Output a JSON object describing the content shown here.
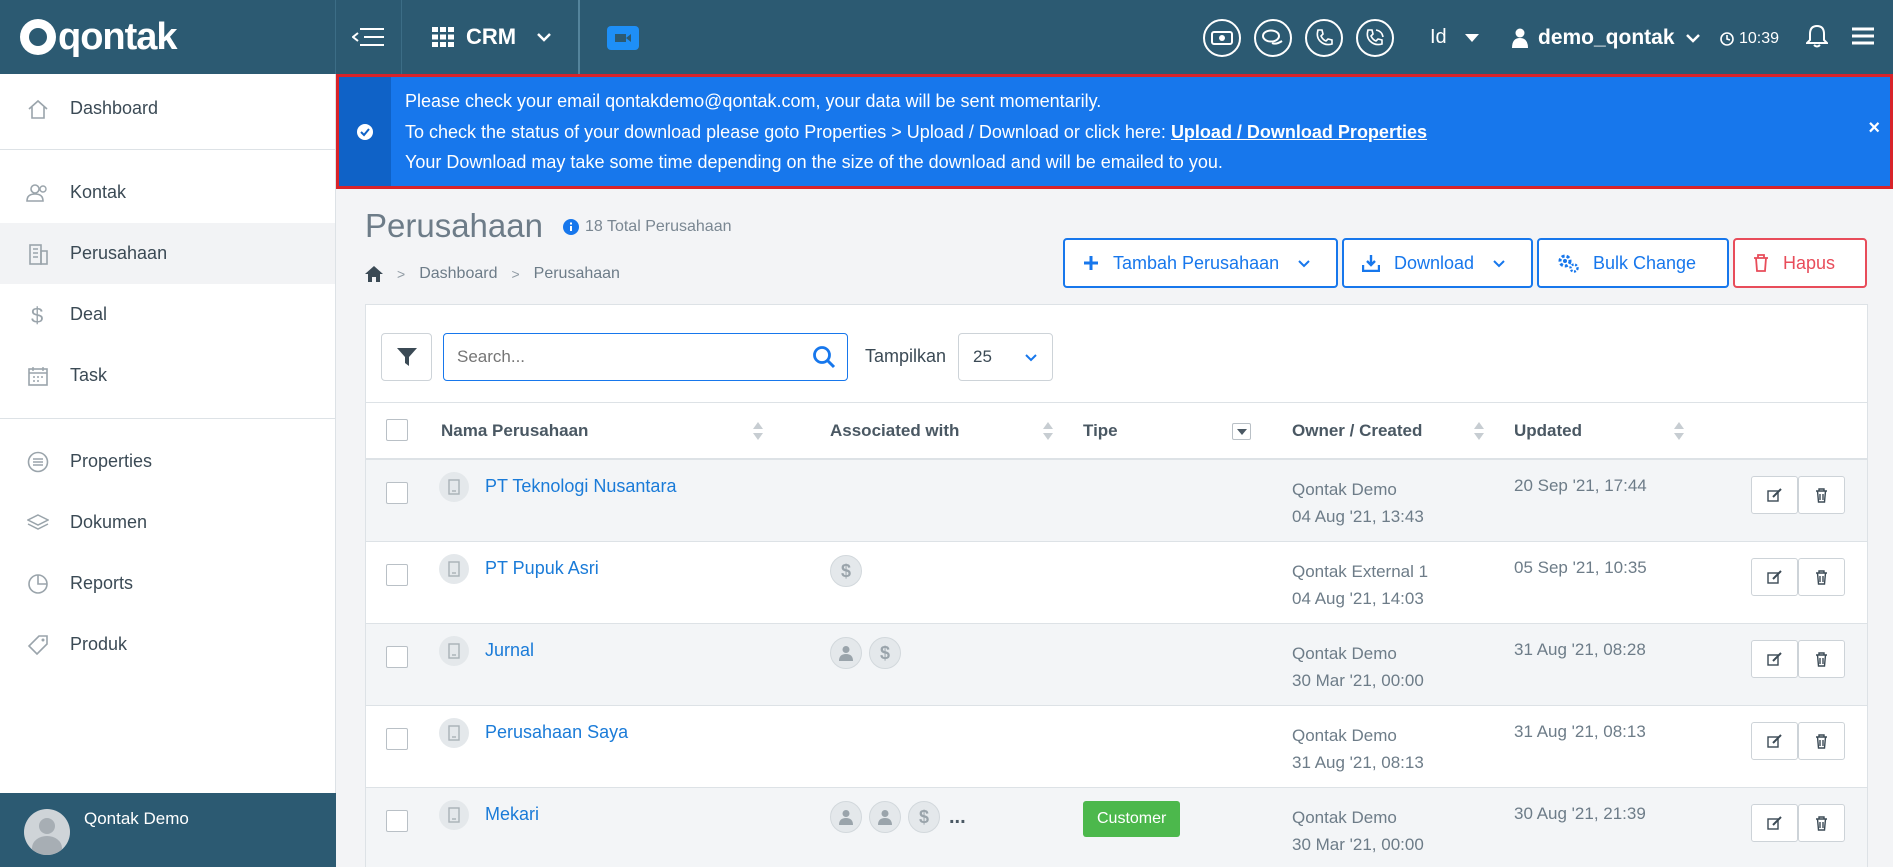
{
  "brand": {
    "logo_text": "qontak"
  },
  "topbar": {
    "app_switch": "CRM",
    "language": "Id",
    "username": "demo_qontak",
    "time": "10:39"
  },
  "sidebar": {
    "items": [
      {
        "label": "Dashboard",
        "icon": "home-icon"
      },
      {
        "label": "Kontak",
        "icon": "users-icon"
      },
      {
        "label": "Perusahaan",
        "icon": "building-icon"
      },
      {
        "label": "Deal",
        "icon": "dollar-icon"
      },
      {
        "label": "Task",
        "icon": "calendar-icon"
      },
      {
        "label": "Properties",
        "icon": "list-icon"
      },
      {
        "label": "Dokumen",
        "icon": "layers-icon"
      },
      {
        "label": "Reports",
        "icon": "pie-chart-icon"
      },
      {
        "label": "Produk",
        "icon": "tag-icon"
      }
    ],
    "footer_user": "Qontak Demo"
  },
  "alert": {
    "line1": "Please check your email qontakdemo@qontak.com, your data will be sent momentarily.",
    "line2_prefix": "To check the status of your download please goto Properties > Upload / Download or click here: ",
    "line2_link": "Upload / Download Properties",
    "line3": "Your Download may take some time depending on the size of the download and will be emailed to you.",
    "close": "×"
  },
  "page": {
    "title": "Perusahaan",
    "total": "18 Total Perusahaan",
    "breadcrumb": [
      "Dashboard",
      "Perusahaan"
    ]
  },
  "actions": {
    "add": "Tambah Perusahaan",
    "download": "Download",
    "bulk": "Bulk Change",
    "delete": "Hapus"
  },
  "toolbar": {
    "search_placeholder": "Search...",
    "show_label": "Tampilkan",
    "show_value": "25"
  },
  "table": {
    "headers": [
      "Nama Perusahaan",
      "Associated with",
      "Tipe",
      "Owner / Created",
      "Updated"
    ],
    "rows": [
      {
        "name": "PT Teknologi Nusantara",
        "assoc": [],
        "tipe": "",
        "owner": "Qontak Demo",
        "created": "04 Aug '21, 13:43",
        "updated": "20 Sep '21, 17:44"
      },
      {
        "name": "PT Pupuk Asri",
        "assoc": [
          "$"
        ],
        "tipe": "",
        "owner": "Qontak External 1",
        "created": "04 Aug '21, 14:03",
        "updated": "05 Sep '21, 10:35"
      },
      {
        "name": "Jurnal",
        "assoc": [
          "person",
          "$"
        ],
        "tipe": "",
        "owner": "Qontak Demo",
        "created": "30 Mar '21, 00:00",
        "updated": "31 Aug '21, 08:28"
      },
      {
        "name": "Perusahaan Saya",
        "assoc": [],
        "tipe": "",
        "owner": "Qontak Demo",
        "created": "31 Aug '21, 08:13",
        "updated": "31 Aug '21, 08:13"
      },
      {
        "name": "Mekari",
        "assoc": [
          "person",
          "person",
          "$"
        ],
        "more": "...",
        "tipe": "Customer",
        "owner": "Qontak Demo",
        "created": "30 Mar '21, 00:00",
        "updated": "30 Aug '21, 21:39"
      }
    ]
  },
  "colors": {
    "topbar": "#2c5a72",
    "alert": "#1777ec",
    "primary": "#1777ec",
    "danger": "#e84c5a",
    "tag_customer": "#4cb84c"
  }
}
